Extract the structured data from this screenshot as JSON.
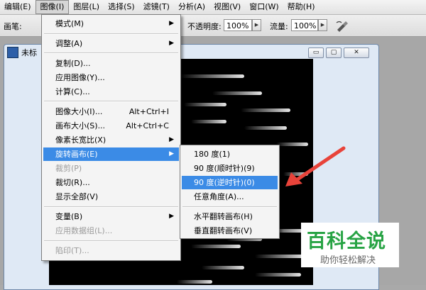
{
  "menubar": {
    "items": [
      "编辑(E)",
      "图像(I)",
      "图层(L)",
      "选择(S)",
      "滤镜(T)",
      "分析(A)",
      "视图(V)",
      "窗口(W)",
      "帮助(H)"
    ]
  },
  "options_bar": {
    "brush_label": "画笔:",
    "opacity_label": "不透明度:",
    "opacity_value": "100%",
    "flow_label": "流量:",
    "flow_value": "100%",
    "airbrush_icon": "airbrush-icon"
  },
  "document": {
    "title": "未标",
    "minimize": "▭",
    "restore": "▢",
    "close": "✕"
  },
  "image_menu": {
    "items": [
      {
        "label": "模式(M)",
        "arrow": "▶"
      },
      {
        "label": "调整(A)",
        "arrow": "▶"
      },
      {
        "label": "复制(D)..."
      },
      {
        "label": "应用图像(Y)..."
      },
      {
        "label": "计算(C)..."
      },
      {
        "label": "图像大小(I)...",
        "shortcut": "Alt+Ctrl+I"
      },
      {
        "label": "画布大小(S)...",
        "shortcut": "Alt+Ctrl+C"
      },
      {
        "label": "像素长宽比(X)",
        "arrow": "▶"
      },
      {
        "label": "旋转画布(E)",
        "arrow": "▶"
      },
      {
        "label": "裁剪(P)"
      },
      {
        "label": "裁切(R)..."
      },
      {
        "label": "显示全部(V)"
      },
      {
        "label": "变量(B)",
        "arrow": "▶"
      },
      {
        "label": "应用数据组(L)..."
      },
      {
        "label": "陷印(T)..."
      }
    ]
  },
  "rotate_submenu": {
    "items": [
      "180 度(1)",
      "90 度(顺时针)(9)",
      "90 度(逆时针)(0)",
      "任意角度(A)...",
      "水平翻转画布(H)",
      "垂直翻转画布(V)"
    ]
  },
  "watermark": {
    "title": "百科全说",
    "subtitle": "助你轻松解决"
  },
  "colors": {
    "highlight": "#3b8be6",
    "annotation_arrow": "#e8433a",
    "watermark_green": "#27a344"
  }
}
